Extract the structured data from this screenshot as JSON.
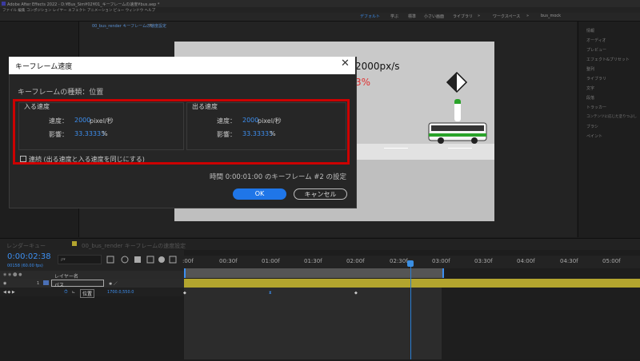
{
  "app": {
    "title": "Adobe After Effects 2022 - D:¥Bus_Sim¥02¥01_キーフレームの速度¥bus.aep *",
    "menu": "ファイル  編集  コンポジション  レイヤー  エフェクト  アニメーション  ビュー  ウィンドウ  ヘルプ"
  },
  "workspaces": [
    "デフォルト",
    "学ぶ",
    "標準",
    "小さい画面",
    "ライブラリ",
    "»",
    "ワークスペース",
    "»",
    "bus_mock"
  ],
  "comp": {
    "tabs": [
      "00_bus_render キーフレームの速度設定",
      "≡"
    ],
    "overlay_speed": "2000px/s",
    "overlay_percent": "3%"
  },
  "right_panel": {
    "items": [
      "情報",
      "オーディオ",
      "プレビュー",
      "エフェクト&プリセット",
      "整列",
      "ライブラリ",
      "文字",
      "段落",
      "トラッカー",
      "コンテンツに応じた塗りつぶし",
      "ブラシ",
      "ペイント"
    ]
  },
  "dialog": {
    "title": "キーフレーム速度",
    "close": "✕",
    "type_label": "キーフレームの種類：位置",
    "incoming": {
      "title": "入る速度",
      "speed_label": "速度：",
      "speed_value": "2000",
      "speed_unit": "pixel/秒",
      "influence_label": "影響：",
      "influence_value": "33.33333",
      "influence_unit": "%"
    },
    "outgoing": {
      "title": "出る速度",
      "speed_label": "速度：",
      "speed_value": "2000",
      "speed_unit": "pixel/秒",
      "influence_label": "影響：",
      "influence_value": "33.33333",
      "influence_unit": "%"
    },
    "continuous_label": "連続 (出る速度と入る速度を同じにする)",
    "status": "時間 0:00:01:00 のキーフレーム #2 の設定",
    "ok": "OK",
    "cancel": "キャンセル"
  },
  "timeline": {
    "tab_render_queue": "レンダーキュー",
    "tab_comp": "00_bus_render キーフレームの速度設定",
    "timecode": "0:00:02:38",
    "frame_info": "00158 (60.00 fps)",
    "search_placeholder": "ρ▾",
    "layer_header": "レイヤー名",
    "layer_number": "1",
    "layer_name": "バス",
    "property_name": "位置",
    "property_value": "1700.0,550.0",
    "ticks": [
      ":00f",
      "00:30f",
      "01:00f",
      "01:30f",
      "02:00f",
      "02:30f",
      "03:00f",
      "03:30f",
      "04:00f",
      "04:30f",
      "05:00f"
    ],
    "playhead_fraction": 0.53
  },
  "colors": {
    "accent": "#2a7fd4",
    "highlight_box": "#cc0000",
    "ok_button": "#1f76e8",
    "value_text": "#3d8ff0",
    "layer_bar": "#b3a52e"
  }
}
